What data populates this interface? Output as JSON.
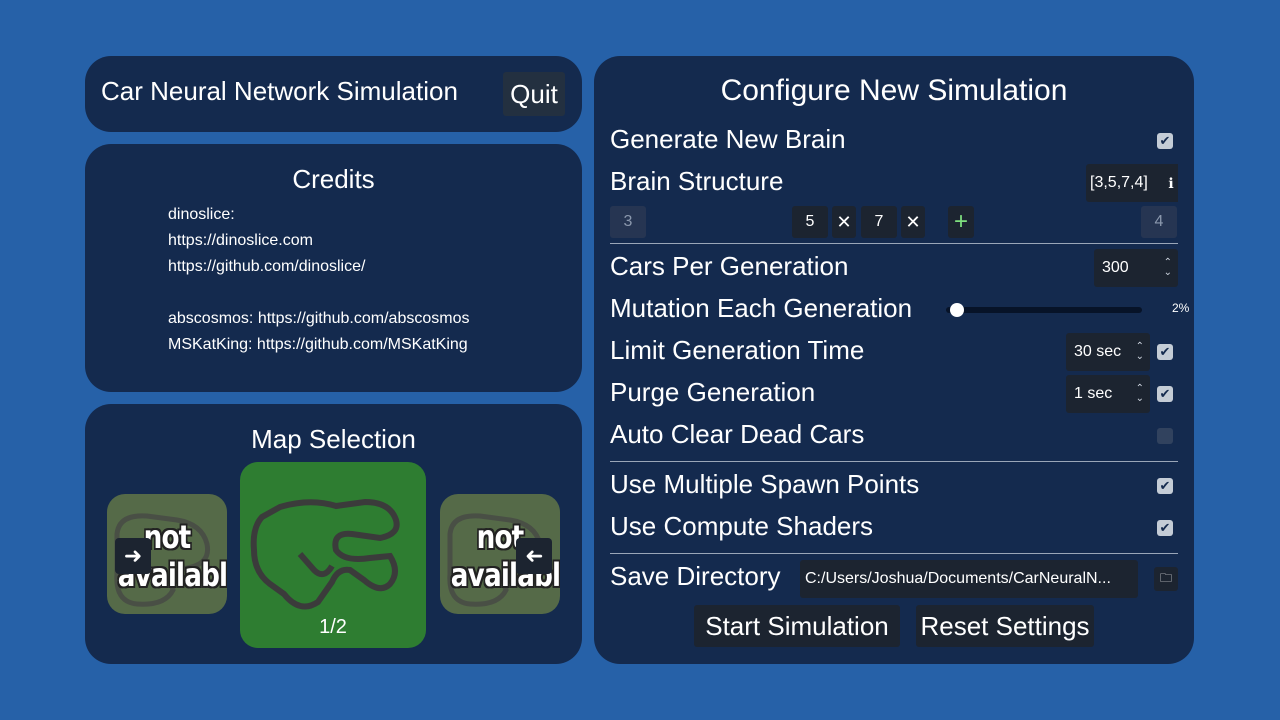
{
  "title_panel": {
    "title": "Car Neural Network Simulation",
    "quit_label": "Quit"
  },
  "credits": {
    "heading": "Credits",
    "lines": [
      "dinoslice:",
      "https://dinoslice.com",
      "https://github.com/dinoslice/",
      "",
      "abscosmos: https://github.com/abscosmos",
      "MSKatKing: https://github.com/MSKatKing"
    ]
  },
  "map_selection": {
    "heading": "Map Selection",
    "left_label": "not available",
    "right_label": "not available",
    "left_label_lines": [
      "not",
      "available"
    ],
    "right_label_lines": [
      "not",
      "available"
    ],
    "page_indicator": "1/2",
    "icons": {
      "prev": "arrow-right-icon",
      "next": "arrow-left-icon"
    }
  },
  "config": {
    "heading": "Configure New Simulation",
    "generate_new_brain": {
      "label": "Generate New Brain",
      "checked": true
    },
    "brain_structure": {
      "label": "Brain Structure",
      "value": "[3,5,7,4]",
      "input_layer": "3",
      "hidden_layers": [
        "5",
        "7"
      ],
      "output_layer": "4",
      "remove_symbol": "✕",
      "add_symbol": "+"
    },
    "cars_per_generation": {
      "label": "Cars Per Generation",
      "value": "300"
    },
    "mutation": {
      "label": "Mutation Each Generation",
      "value_text": "2%",
      "percent": 2
    },
    "limit_generation_time": {
      "label": "Limit Generation Time",
      "value": "30 sec",
      "checked": true
    },
    "purge_generation": {
      "label": "Purge Generation",
      "value": "1 sec",
      "checked": true
    },
    "auto_clear_dead_cars": {
      "label": "Auto Clear Dead Cars",
      "checked": false
    },
    "use_multiple_spawn_points": {
      "label": "Use Multiple Spawn Points",
      "checked": true
    },
    "use_compute_shaders": {
      "label": "Use Compute Shaders",
      "checked": true
    },
    "save_directory": {
      "label": "Save Directory",
      "value": "C:/Users/Joshua/Documents/CarNeuralN..."
    },
    "start_label": "Start Simulation",
    "reset_label": "Reset Settings",
    "check_glyph": "✔"
  },
  "colors": {
    "background": "#2661a8",
    "panel": "#142a4e",
    "control": "#1c2430",
    "map_green": "#2e7d31",
    "plus_green": "#7fe07f"
  }
}
